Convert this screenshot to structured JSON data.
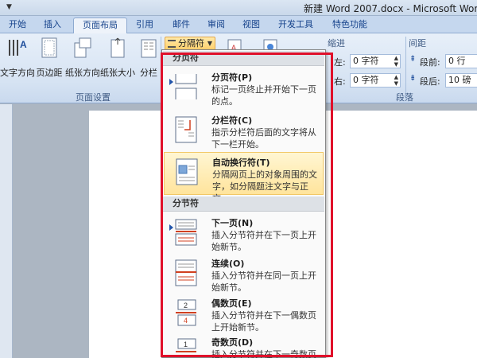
{
  "window": {
    "title": "新建 Word 2007.docx - Microsoft Word"
  },
  "tabs": [
    {
      "label": "开始"
    },
    {
      "label": "插入"
    },
    {
      "label": "页面布局"
    },
    {
      "label": "引用"
    },
    {
      "label": "邮件"
    },
    {
      "label": "审阅"
    },
    {
      "label": "视图"
    },
    {
      "label": "开发工具"
    },
    {
      "label": "特色功能"
    }
  ],
  "ribbon": {
    "page_setup": {
      "label": "页面设置",
      "buttons": [
        {
          "label": "文字方向"
        },
        {
          "label": "页边距"
        },
        {
          "label": "纸张方向"
        },
        {
          "label": "纸张大小"
        },
        {
          "label": "分栏"
        }
      ],
      "breaks_label": "分隔符"
    },
    "indent": {
      "label": "缩进",
      "left_label": "左:",
      "left_value": "0 字符",
      "right_label": "右:",
      "right_value": "0 字符"
    },
    "spacing": {
      "label": "间距",
      "before_label": "段前:",
      "before_value": "0 行",
      "after_label": "段后:",
      "after_value": "10 磅"
    },
    "paragraph_label": "段落"
  },
  "breaks_menu": {
    "page_breaks_header": "分页符",
    "section_breaks_header": "分节符",
    "items": [
      {
        "title": "分页符(P)",
        "desc": "标记一页终止并开始下一页的点。"
      },
      {
        "title": "分栏符(C)",
        "desc": "指示分栏符后面的文字将从下一栏开始。"
      },
      {
        "title": "自动换行符(T)",
        "desc": "分隔网页上的对象周围的文字，如分隔题注文字与正文。"
      },
      {
        "title": "下一页(N)",
        "desc": "插入分节符并在下一页上开始新节。"
      },
      {
        "title": "连续(O)",
        "desc": "插入分节符并在同一页上开始新节。"
      },
      {
        "title": "偶数页(E)",
        "desc": "插入分节符并在下一偶数页上开始新节。"
      },
      {
        "title": "奇数页(D)",
        "desc": "插入分节符并在下一奇数页上开始新节。"
      }
    ]
  },
  "colors": {
    "highlight_box": "#e0102a",
    "menu_hover": "#ffe49c",
    "accent": "#15428b"
  }
}
